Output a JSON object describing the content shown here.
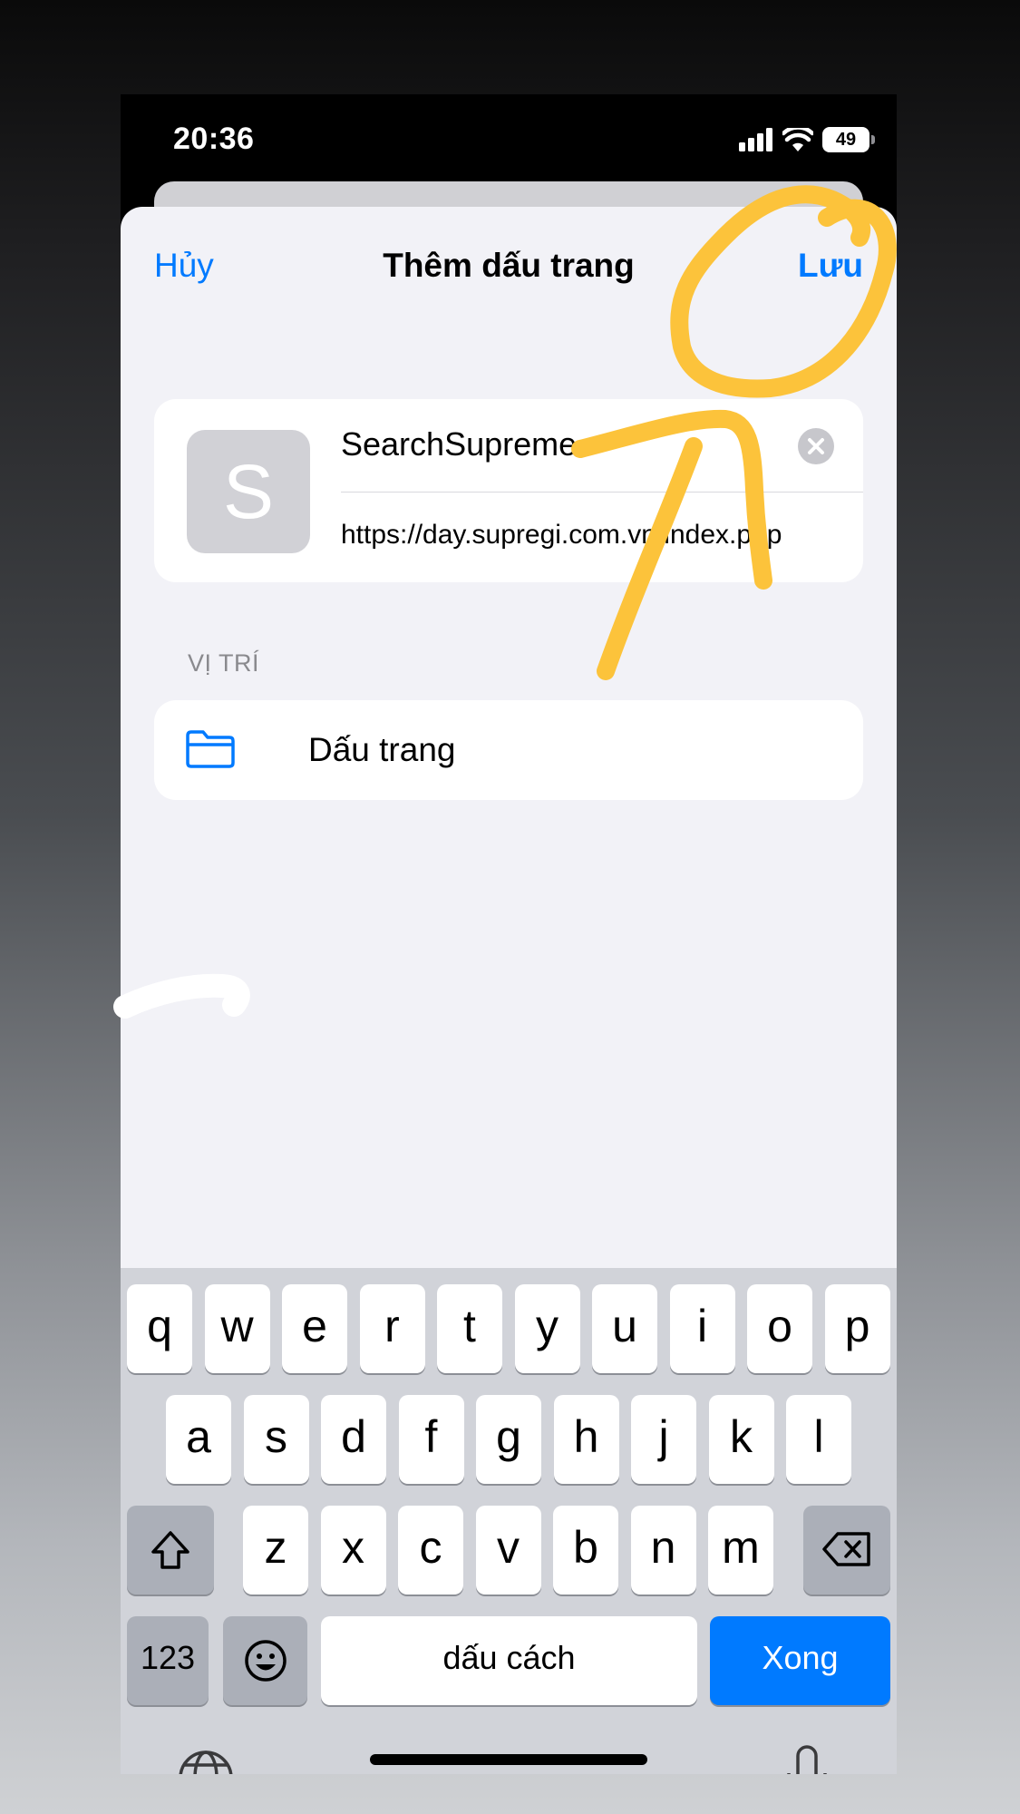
{
  "status_bar": {
    "time": "20:36",
    "battery": "49"
  },
  "nav": {
    "cancel_label": "Hủy",
    "title": "Thêm dấu trang",
    "save_label": "Lưu"
  },
  "bookmark": {
    "favicon_letter": "S",
    "title_value": "SearchSupreme",
    "url_value": "https://day.supregi.com.vn/index.php"
  },
  "location": {
    "section_label": "VỊ TRÍ",
    "folder_label": "Dấu trang"
  },
  "keyboard": {
    "row1": [
      "q",
      "w",
      "e",
      "r",
      "t",
      "y",
      "u",
      "i",
      "o",
      "p"
    ],
    "row2": [
      "a",
      "s",
      "d",
      "f",
      "g",
      "h",
      "j",
      "k",
      "l"
    ],
    "row3": [
      "z",
      "x",
      "c",
      "v",
      "b",
      "n",
      "m"
    ],
    "numbers_label": "123",
    "space_label": "dấu cách",
    "done_label": "Xong"
  },
  "colors": {
    "accent": "#007aff",
    "annotation": "#fcc33b"
  },
  "icons": [
    "signal-icon",
    "wifi-icon",
    "battery-icon",
    "clear-icon",
    "folder-icon",
    "shift-icon",
    "delete-icon",
    "emoji-icon",
    "globe-icon",
    "microphone-icon"
  ]
}
